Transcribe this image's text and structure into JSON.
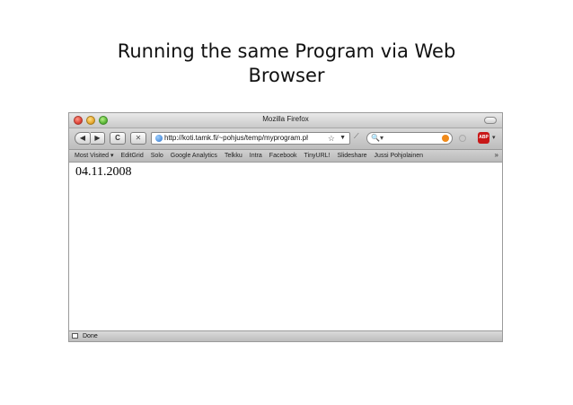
{
  "slide": {
    "title_line1": "Running the same Program via Web",
    "title_line2": "Browser"
  },
  "window": {
    "title": "Mozilla Firefox"
  },
  "toolbar": {
    "back_label": "◀",
    "forward_label": "▶",
    "reload_label": "C",
    "stop_label": "✕",
    "url": "http://koti.tamk.fi/~pohjus/temp/myprogram.php",
    "bookmark_star": "☆",
    "url_dropdown": "▼",
    "feed_label": "⟋",
    "search_icon": "🔍▾",
    "search_placeholder": "",
    "adblock_label": "ABP",
    "adblock_dropdown": "▾"
  },
  "bookmarks": {
    "items": [
      "Most Visited ▾",
      "EditGrid",
      "Solo",
      "Google Analytics",
      "Telkku",
      "Intra",
      "Facebook",
      "TinyURL!",
      "Slideshare",
      "Jussi Pohjolainen"
    ],
    "more": "»"
  },
  "page": {
    "date": "04.11.2008"
  },
  "status": {
    "text": "Done"
  }
}
